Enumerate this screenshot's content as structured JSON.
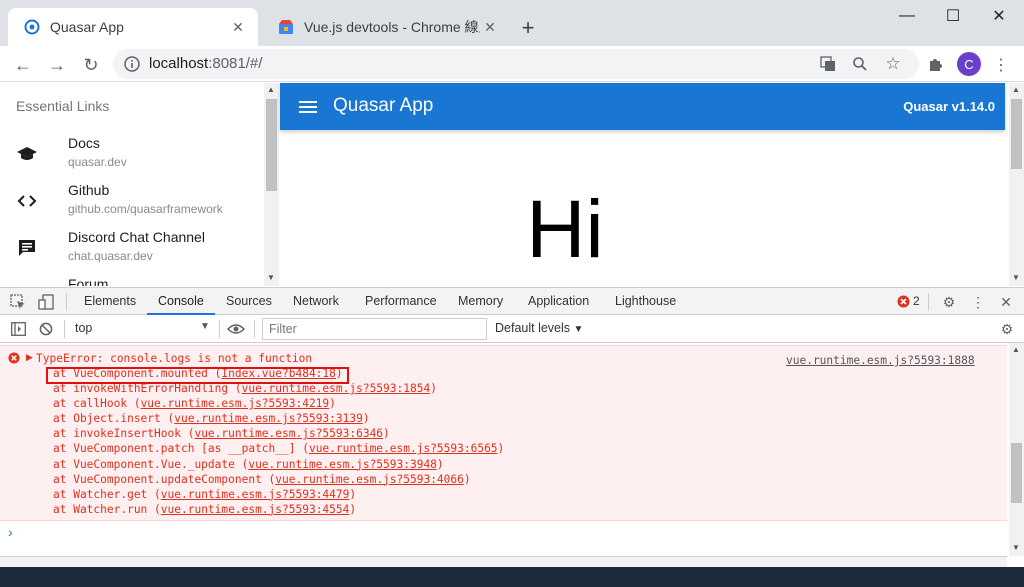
{
  "browser": {
    "tabs": [
      {
        "label": "Quasar App",
        "active": true
      },
      {
        "label": "Vue.js devtools - Chrome 線上應用程式",
        "active": false
      }
    ],
    "url_host": "localhost",
    "url_rest": ":8081/#/",
    "avatar_letter": "C"
  },
  "app": {
    "drawer_header": "Essential Links",
    "links": [
      {
        "title": "Docs",
        "caption": "quasar.dev",
        "icon": "school-icon"
      },
      {
        "title": "Github",
        "caption": "github.com/quasarframework",
        "icon": "code-icon"
      },
      {
        "title": "Discord Chat Channel",
        "caption": "chat.quasar.dev",
        "icon": "chat-icon"
      },
      {
        "title": "Forum",
        "caption": "",
        "icon": "forum-icon"
      }
    ],
    "title": "Quasar App",
    "version": "Quasar v1.14.0",
    "greeting": "Hi",
    "primary_color": "#1976d2"
  },
  "devtools": {
    "tabs": [
      "Elements",
      "Console",
      "Sources",
      "Network",
      "Performance",
      "Memory",
      "Application",
      "Lighthouse"
    ],
    "active_tab": "Console",
    "error_count": "2",
    "context": "top",
    "filter_placeholder": "Filter",
    "levels": "Default levels",
    "error": {
      "message": "TypeError: console.logs is not a function",
      "source": "vue.runtime.esm.js?5593:1888",
      "stack": [
        {
          "fn": "at VueComponent.mounted (",
          "loc": "Index.vue?b484:18",
          "tail": ")"
        },
        {
          "fn": "at invokeWithErrorHandling (",
          "loc": "vue.runtime.esm.js?5593:1854",
          "tail": ")"
        },
        {
          "fn": "at callHook (",
          "loc": "vue.runtime.esm.js?5593:4219",
          "tail": ")"
        },
        {
          "fn": "at Object.insert (",
          "loc": "vue.runtime.esm.js?5593:3139",
          "tail": ")"
        },
        {
          "fn": "at invokeInsertHook (",
          "loc": "vue.runtime.esm.js?5593:6346",
          "tail": ")"
        },
        {
          "fn": "at VueComponent.patch [as __patch__] (",
          "loc": "vue.runtime.esm.js?5593:6565",
          "tail": ")"
        },
        {
          "fn": "at VueComponent.Vue._update (",
          "loc": "vue.runtime.esm.js?5593:3948",
          "tail": ")"
        },
        {
          "fn": "at VueComponent.updateComponent (",
          "loc": "vue.runtime.esm.js?5593:4066",
          "tail": ")"
        },
        {
          "fn": "at Watcher.get (",
          "loc": "vue.runtime.esm.js?5593:4479",
          "tail": ")"
        },
        {
          "fn": "at Watcher.run (",
          "loc": "vue.runtime.esm.js?5593:4554",
          "tail": ")"
        }
      ]
    },
    "prompt_glyph": "›"
  }
}
